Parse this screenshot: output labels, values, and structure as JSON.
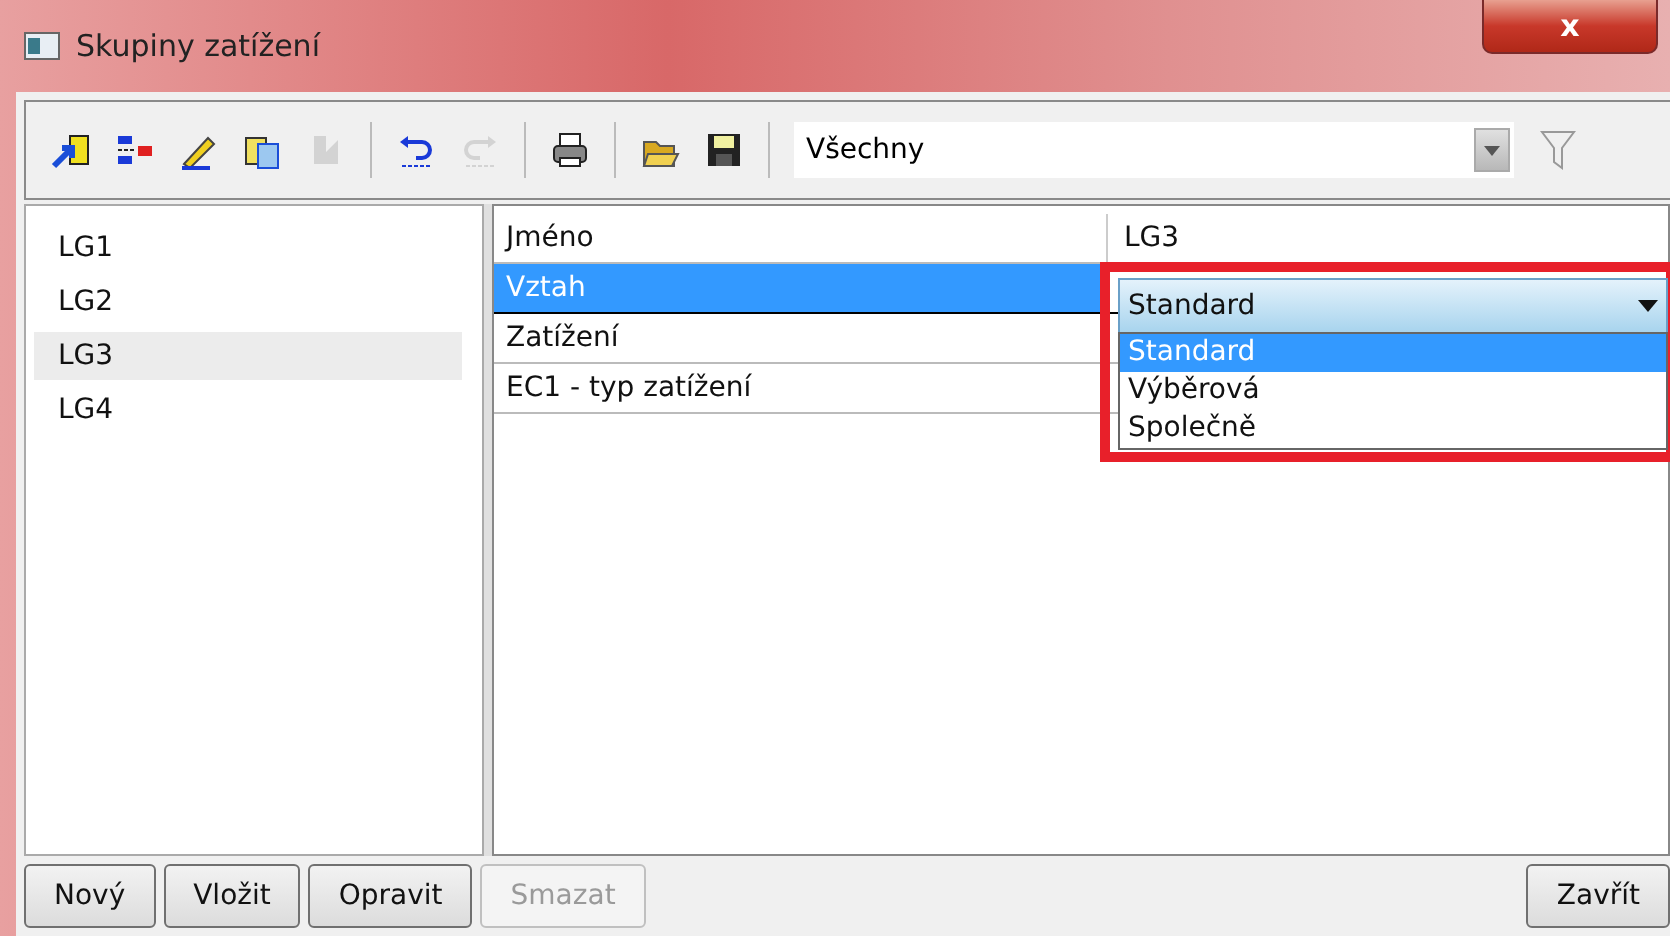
{
  "window": {
    "title": "Skupiny zatížení",
    "close": "x"
  },
  "toolbar": {
    "icons": [
      {
        "kind": "new",
        "disabled": false
      },
      {
        "kind": "split",
        "disabled": false
      },
      {
        "kind": "edit",
        "disabled": false
      },
      {
        "kind": "copy",
        "disabled": false
      },
      {
        "kind": "flag",
        "disabled": true
      },
      {
        "kind": "undo",
        "disabled": false
      },
      {
        "kind": "redo",
        "disabled": true
      },
      {
        "kind": "print",
        "disabled": false
      },
      {
        "kind": "open",
        "disabled": false
      },
      {
        "kind": "save",
        "disabled": false
      }
    ],
    "filter": "Všechny"
  },
  "groups": [
    {
      "label": "LG1",
      "selected": false
    },
    {
      "label": "LG2",
      "selected": false
    },
    {
      "label": "LG3",
      "selected": true
    },
    {
      "label": "LG4",
      "selected": false
    }
  ],
  "properties": [
    {
      "name": "Jméno",
      "value": "LG3",
      "selected": false
    },
    {
      "name": "Vztah",
      "selected": true,
      "editor": {
        "value": "Standard",
        "options": [
          {
            "label": "Standard",
            "selected": true
          },
          {
            "label": "Výběrová",
            "selected": false
          },
          {
            "label": "Společně",
            "selected": false
          }
        ]
      }
    },
    {
      "name": "Zatížení",
      "selected": false
    },
    {
      "name": "EC1 - typ zatížení",
      "selected": false
    }
  ],
  "buttons": [
    {
      "label": "Nový",
      "disabled": false
    },
    {
      "label": "Vložit",
      "disabled": false
    },
    {
      "label": "Opravit",
      "disabled": false
    },
    {
      "label": "Smazat",
      "disabled": true
    }
  ],
  "close_button": "Zavřít"
}
